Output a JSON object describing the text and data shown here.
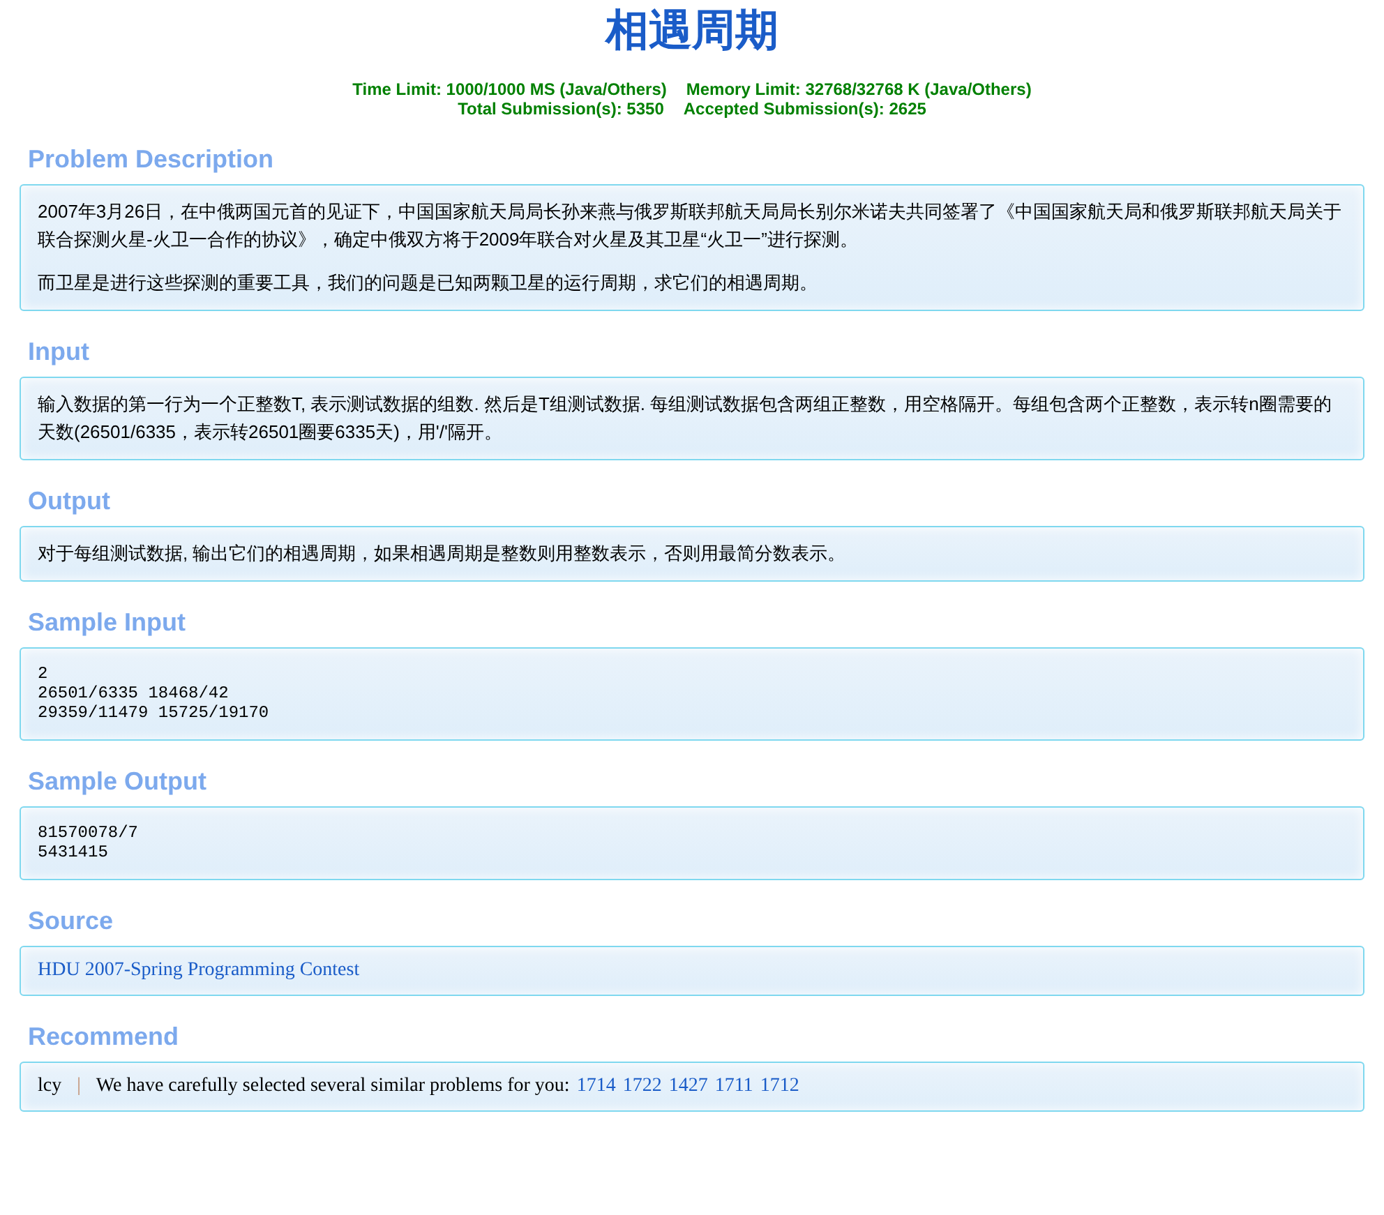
{
  "title": "相遇周期",
  "limits": [
    "Time Limit: 1000/1000 MS (Java/Others)",
    "Memory Limit: 32768/32768 K (Java/Others)",
    "Total Submission(s): 5350",
    "Accepted Submission(s): 2625"
  ],
  "sections": [
    {
      "kind": "text",
      "heading": "Problem Description",
      "paragraphs": [
        "2007年3月26日，在中俄两国元首的见证下，中国国家航天局局长孙来燕与俄罗斯联邦航天局局长别尔米诺夫共同签署了《中国国家航天局和俄罗斯联邦航天局关于联合探测火星-火卫一合作的协议》，确定中俄双方将于2009年联合对火星及其卫星“火卫一”进行探测。",
        "而卫星是进行这些探测的重要工具，我们的问题是已知两颗卫星的运行周期，求它们的相遇周期。"
      ]
    },
    {
      "kind": "text",
      "heading": "Input",
      "paragraphs": [
        "输入数据的第一行为一个正整数T, 表示测试数据的组数. 然后是T组测试数据. 每组测试数据包含两组正整数，用空格隔开。每组包含两个正整数，表示转n圈需要的天数(26501/6335，表示转26501圈要6335天)，用'/'隔开。"
      ]
    },
    {
      "kind": "text",
      "heading": "Output",
      "paragraphs": [
        "对于每组测试数据, 输出它们的相遇周期，如果相遇周期是整数则用整数表示，否则用最简分数表示。"
      ]
    },
    {
      "kind": "code",
      "heading": "Sample Input",
      "lines": [
        "2",
        "26501/6335 18468/42",
        "29359/11479 15725/19170"
      ]
    },
    {
      "kind": "code",
      "heading": "Sample Output",
      "lines": [
        "81570078/7",
        "5431415"
      ]
    },
    {
      "kind": "link",
      "heading": "Source",
      "link": "HDU 2007-Spring Programming Contest"
    },
    {
      "kind": "recommend",
      "heading": "Recommend",
      "author": "lcy",
      "separator": "|",
      "text": "We have carefully selected several similar problems for you:",
      "problems": [
        "1714",
        "1722",
        "1427",
        "1711",
        "1712"
      ]
    }
  ]
}
